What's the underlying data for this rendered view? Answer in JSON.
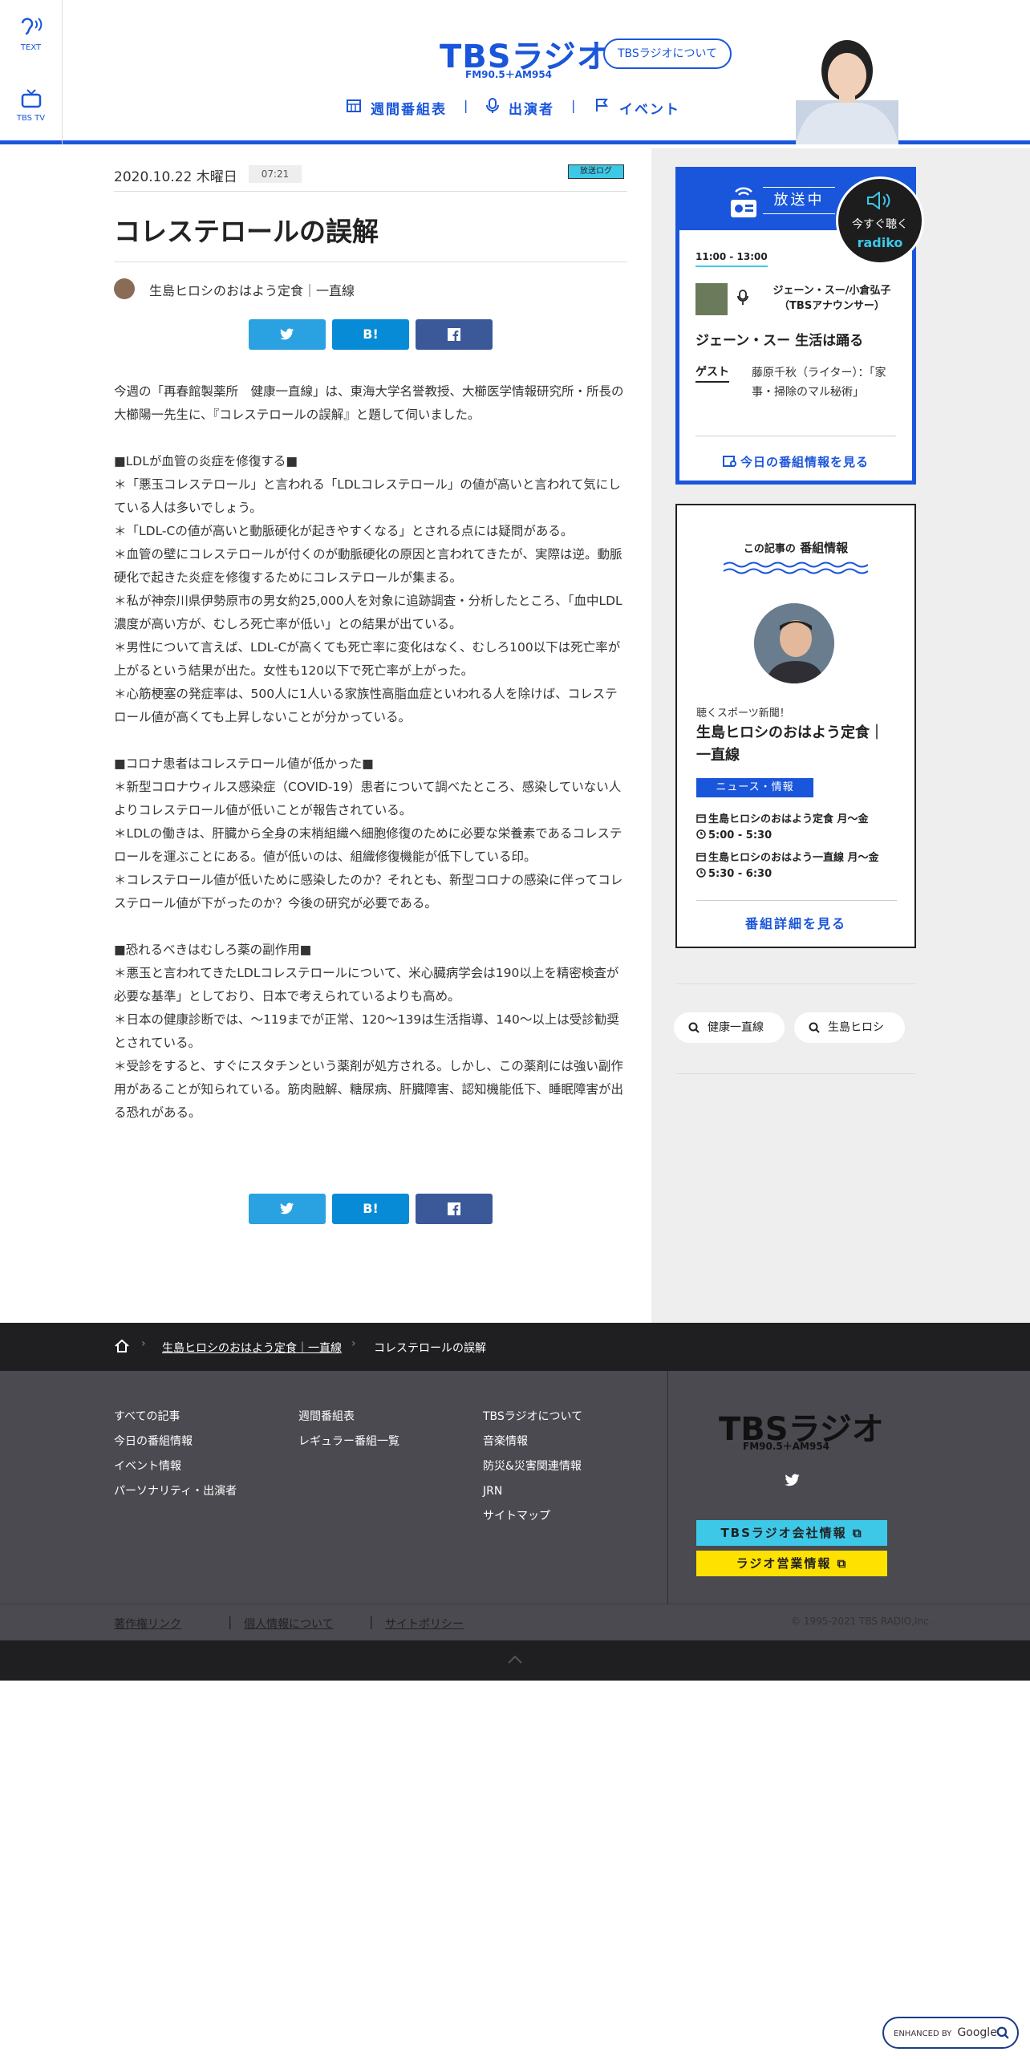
{
  "header": {
    "side_text": "TEXT",
    "side_tv": "TBS TV",
    "logo": "TBSラジオ",
    "logo_sub": "FM90.5＋AM954",
    "about": "TBSラジオについて",
    "nav": [
      "週間番組表",
      "出演者",
      "イベント"
    ]
  },
  "article": {
    "date": "2020.10.22 木曜日",
    "time": "07:21",
    "badge": "放送ログ",
    "title": "コレステロールの誤解",
    "author": "生島ヒロシのおはよう定食｜一直線",
    "share": {
      "twitter": "",
      "hatena": "B!",
      "facebook": ""
    },
    "paragraphs": [
      [
        "今週の「再春館製薬所　健康一直線」は、東海大学名誉教授、大櫛医学情報研究所・所長の大櫛陽一先生に、『コレステロールの誤解』と題して伺いました。"
      ],
      [
        "■LDLが血管の炎症を修復する■",
        "＊「悪玉コレステロール」と言われる「LDLコレステロール」の値が高いと言われて気にしている人は多いでしょう。",
        "＊「LDL-Cの値が高いと動脈硬化が起きやすくなる」とされる点には疑問がある。",
        "＊血管の壁にコレステロールが付くのが動脈硬化の原因と言われてきたが、実際は逆。動脈硬化で起きた炎症を修復するためにコレステロールが集まる。",
        "＊私が神奈川県伊勢原市の男女約25,000人を対象に追跡調査・分析したところ、「血中LDL濃度が高い方が、むしろ死亡率が低い」との結果が出ている。",
        "＊男性について言えば、LDL-Cが高くても死亡率に変化はなく、むしろ100以下は死亡率が上がるという結果が出た。女性も120以下で死亡率が上がった。",
        "＊心筋梗塞の発症率は、500人に1人いる家族性高脂血症といわれる人を除けば、コレステロール値が高くても上昇しないことが分かっている。"
      ],
      [
        "■コロナ患者はコレステロール値が低かった■",
        "＊新型コロナウィルス感染症（COVID-19）患者について調べたところ、感染していない人よりコレステロール値が低いことが報告されている。",
        "＊LDLの働きは、肝臓から全身の末梢組織へ細胞修復のために必要な栄養素であるコレステロールを運ぶことにある。値が低いのは、組織修復機能が低下している印。",
        "＊コレステロール値が低いために感染したのか？それとも、新型コロナの感染に伴ってコレステロール値が下がったのか？今後の研究が必要である。"
      ],
      [
        "■恐れるべきはむしろ薬の副作用■",
        "＊悪玉と言われてきたLDLコレステロールについて、米心臓病学会は190以上を精密検査が必要な基準」としており、日本で考えられているよりも高め。",
        "＊日本の健康診断では、～119までが正常、120～139は生活指導、140～以上は受診勧奨とされている。",
        "＊受診をすると、すぐにスタチンという薬剤が処方される。しかし、この薬剤には強い副作用があることが知られている。筋肉融解、糖尿病、肝臓障害、認知機能低下、睡眠障害が出る恐れがある。"
      ]
    ]
  },
  "onair": {
    "label": "放送中",
    "radiko_line1": "今すぐ聴く",
    "radiko_line2": "radiko",
    "time": "11:00 - 13:00",
    "host": "ジェーン・スー/小倉弘子（TBSアナウンサー）",
    "program": "ジェーン・スー 生活は踊る",
    "guest_label": "ゲスト",
    "guest": "藤原千秋（ライター）：「家事・掃除のマル秘術」",
    "today_link": "今日の番組情報を見る"
  },
  "program_info": {
    "title_pre": "この記事の",
    "title_main": "番組情報",
    "kicker": "聴くスポーツ新聞！",
    "name": "生島ヒロシのおはよう定食｜一直線",
    "category": "ニュース・情報",
    "rows": [
      {
        "icon": "calendar",
        "text": "生島ヒロシのおはよう定食 月〜金"
      },
      {
        "icon": "clock",
        "text": "5:00 - 5:30"
      },
      {
        "icon": "calendar",
        "text": "生島ヒロシのおはよう一直線 月〜金"
      },
      {
        "icon": "clock",
        "text": "5:30 - 6:30"
      }
    ],
    "detail_link": "番組詳細を見る"
  },
  "tags": [
    "健康一直線",
    "生島ヒロシ"
  ],
  "breadcrumb": {
    "item1": "生島ヒロシのおはよう定食｜一直線",
    "item2": "コレステロールの誤解"
  },
  "footer": {
    "col1": [
      "すべての記事",
      "今日の番組情報",
      "イベント情報",
      "パーソナリティ・出演者"
    ],
    "col2": [
      "週間番組表",
      "レギュラー番組一覧"
    ],
    "col3": [
      "TBSラジオについて",
      "音楽情報",
      "防災&災害関連情報",
      "JRN",
      "サイトマップ"
    ],
    "logo": "TBSラジオ",
    "logo_sub": "FM90.5＋AM954",
    "company_btn": "TBSラジオ会社情報",
    "sales_btn": "ラジオ営業情報",
    "bottom_links": [
      "著作権リンク",
      "個人情報について",
      "サイトポリシー"
    ],
    "copyright": "© 1995-2021 TBS RADIO,Inc."
  },
  "google_badge": {
    "prefix": "ENHANCED BY",
    "brand": "Google"
  },
  "colors": {
    "brand_blue": "#1a56db",
    "cyan": "#3ec8e8",
    "yellow": "#ffe100",
    "footer_dark": "#1f1f22"
  }
}
